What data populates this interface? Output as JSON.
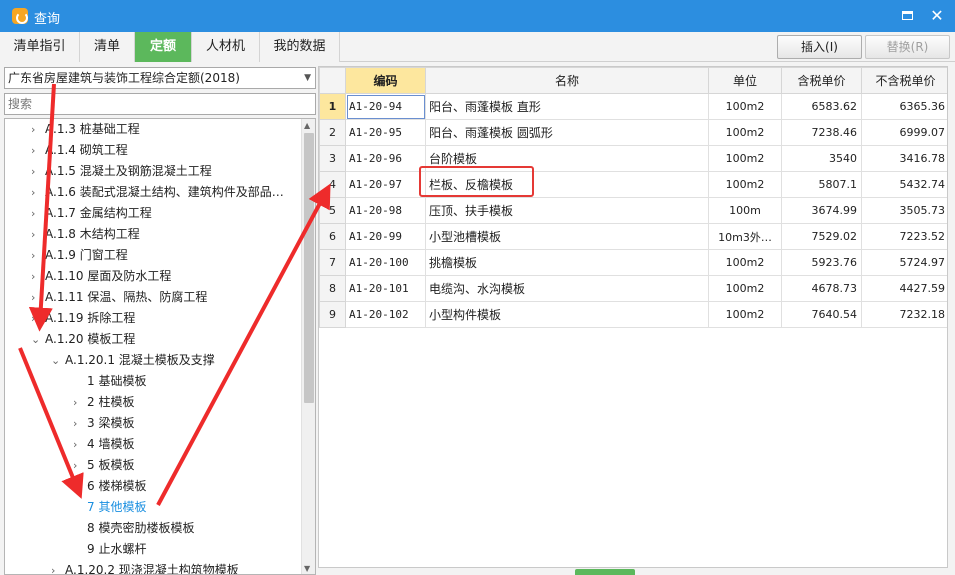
{
  "window": {
    "title": "查询",
    "minimize_glyph": "",
    "close_glyph": "✕"
  },
  "tabs": [
    {
      "label": "清单指引"
    },
    {
      "label": "清单"
    },
    {
      "label": "定额"
    },
    {
      "label": "人材机"
    },
    {
      "label": "我的数据"
    }
  ],
  "toolbar": {
    "insert_label": "插入(I)",
    "replace_label": "替换(R)"
  },
  "left": {
    "dropdown_value": "广东省房屋建筑与装饰工程综合定额(2018)",
    "search_placeholder": "搜索",
    "tree": [
      {
        "chev": "›",
        "text": "A.1.3 桩基础工程"
      },
      {
        "chev": "›",
        "text": "A.1.4 砌筑工程"
      },
      {
        "chev": "›",
        "text": "A.1.5 混凝土及钢筋混凝土工程"
      },
      {
        "chev": "›",
        "text": "A.1.6 装配式混凝土结构、建筑构件及部品…"
      },
      {
        "chev": "›",
        "text": "A.1.7 金属结构工程"
      },
      {
        "chev": "›",
        "text": "A.1.8 木结构工程"
      },
      {
        "chev": "›",
        "text": "A.1.9 门窗工程"
      },
      {
        "chev": "›",
        "text": "A.1.10 屋面及防水工程"
      },
      {
        "chev": "›",
        "text": "A.1.11 保温、隔热、防腐工程"
      },
      {
        "chev": "›",
        "text": "A.1.19 拆除工程"
      },
      {
        "chev": "⌄",
        "text": "A.1.20 模板工程"
      },
      {
        "chev": "⌄",
        "text": "A.1.20.1 混凝土模板及支撑"
      },
      {
        "chev": "",
        "text": "1 基础模板"
      },
      {
        "chev": "›",
        "text": "2 柱模板"
      },
      {
        "chev": "›",
        "text": "3 梁模板"
      },
      {
        "chev": "›",
        "text": "4 墙模板"
      },
      {
        "chev": "›",
        "text": "5 板模板"
      },
      {
        "chev": "›",
        "text": "6 楼梯模板"
      },
      {
        "chev": "",
        "text": "7 其他模板"
      },
      {
        "chev": "",
        "text": "8 模壳密肋楼板模板"
      },
      {
        "chev": "",
        "text": "9 止水螺杆"
      },
      {
        "chev": "›",
        "text": "A.1.20.2 现浇混凝土构筑物模板"
      }
    ]
  },
  "table": {
    "headers": {
      "code": "编码",
      "name": "名称",
      "unit": "单位",
      "tax_price": "含税单价",
      "notax_price": "不含税单价"
    },
    "rows": [
      {
        "n": "1",
        "code": "A1-20-94",
        "name": "阳台、雨蓬模板 直形",
        "unit": "100m2",
        "tax": "6583.62",
        "notax": "6365.36"
      },
      {
        "n": "2",
        "code": "A1-20-95",
        "name": "阳台、雨蓬模板 圆弧形",
        "unit": "100m2",
        "tax": "7238.46",
        "notax": "6999.07"
      },
      {
        "n": "3",
        "code": "A1-20-96",
        "name": "台阶模板",
        "unit": "100m2",
        "tax": "3540",
        "notax": "3416.78"
      },
      {
        "n": "4",
        "code": "A1-20-97",
        "name": "栏板、反檐模板",
        "unit": "100m2",
        "tax": "5807.1",
        "notax": "5432.74"
      },
      {
        "n": "5",
        "code": "A1-20-98",
        "name": "压顶、扶手模板",
        "unit": "100m",
        "tax": "3674.99",
        "notax": "3505.73"
      },
      {
        "n": "6",
        "code": "A1-20-99",
        "name": "小型池槽模板",
        "unit": "10m3外…",
        "tax": "7529.02",
        "notax": "7223.52"
      },
      {
        "n": "7",
        "code": "A1-20-100",
        "name": "挑檐模板",
        "unit": "100m2",
        "tax": "5923.76",
        "notax": "5724.97"
      },
      {
        "n": "8",
        "code": "A1-20-101",
        "name": "电缆沟、水沟模板",
        "unit": "100m2",
        "tax": "4678.73",
        "notax": "4427.59"
      },
      {
        "n": "9",
        "code": "A1-20-102",
        "name": "小型构件模板",
        "unit": "100m2",
        "tax": "7640.54",
        "notax": "7232.18"
      }
    ]
  },
  "annotations": {
    "arrow_color": "#ee2b2b",
    "highlight_color": "#e53935"
  }
}
